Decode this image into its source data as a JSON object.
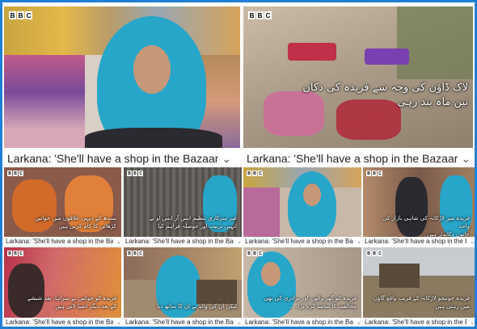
{
  "brand": "BBC",
  "title_text": "Larkana: 'She'll have a shop in the Bazaar",
  "chevron": "⌄",
  "colors": {
    "border": "#1f7fd4",
    "scarf": "#27a6c9",
    "caption_text": "#222222"
  },
  "big_tiles": [
    {
      "caption": "Larkana: 'She'll have a shop in the Bazaar",
      "subtitle": "",
      "icon": "chevron-down-icon"
    },
    {
      "caption": "Larkana: 'She'll have a shop in the Bazaar",
      "subtitle_line1": "لاک ڈاؤن کی وجہ سے فریدہ کی دکان",
      "subtitle_line2": "تین ماہ بند رہی",
      "icon": "chevron-down-icon"
    }
  ],
  "small_tiles": [
    {
      "caption": "Larkana: 'She'll have a shop in the Bazaar",
      "sub1": "سندھ کے دیہی علاقوں میں خواتین",
      "sub2": "کڑھائی کا کام کرتی ہیں"
    },
    {
      "caption": "Larkana: 'She'll have a shop in the Bazaar",
      "sub1": "غیر سرکاری تنظیم ایس آر ایس او نے",
      "sub2": "انہیں تربیت اور حوصلہ فراہم کیا"
    },
    {
      "caption": "Larkana: 'She'll have a shop in the Bazaar",
      "sub1": "",
      "sub2": ""
    },
    {
      "caption": "Larkana: 'She'll have a shop in the Bazaar",
      "sub1": "فریدہ میر لاڑکانہ کی شاہی بازار کی واحد",
      "sub2": "خاتون دکاندار ہیں"
    },
    {
      "caption": "Larkana: 'She'll have a shop in the Bazaar",
      "sub1": "فریدہ کو خواتین نے سراہا، بعد شیشے",
      "sub2": "کے بعد دیگر اشیا لاتی ہیں"
    },
    {
      "caption": "Larkana: 'She'll have a shop in the Bazaar",
      "sub1": "لیکن ان کی والد نے ان کا ساتھ دیا",
      "sub2": ""
    },
    {
      "caption": "Larkana: 'She'll have a shop in the Bazaar",
      "sub1": "فریدہ کو گھر والوں اور برادری کی بھی",
      "sub2": "مخالفت کا سامنا کرنا پڑا۔۔۔"
    },
    {
      "caption": "Larkana: 'She'll have a shop in the Bazaar",
      "sub1": "فریدہ جونیجو لاڑکانہ کے قریب واقع گاؤں",
      "sub2": "میں رہتی ہیں"
    }
  ]
}
